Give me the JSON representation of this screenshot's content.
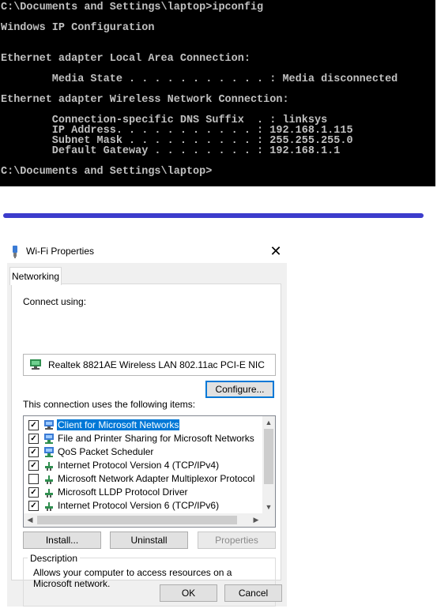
{
  "console": {
    "lines": [
      "C:\\Documents and Settings\\laptop>ipconfig",
      "Windows IP Configuration",
      "Ethernet adapter Local Area Connection:",
      "        Media State . . . . . . . . . . . : Media disconnected",
      "Ethernet adapter Wireless Network Connection:",
      "        Connection-specific DNS Suffix  . : linksys",
      "        IP Address. . . . . . . . . . . : 192.168.1.115",
      "        Subnet Mask . . . . . . . . . . : 255.255.255.0",
      "        Default Gateway . . . . . . . . : 192.168.1.1",
      "C:\\Documents and Settings\\laptop>"
    ]
  },
  "dialog": {
    "title": "Wi-Fi Properties",
    "close_glyph": "✕",
    "tab_label": "Networking",
    "connect_using_label": "Connect using:",
    "adapter_name": "Realtek 8821AE Wireless LAN 802.11ac PCI-E NIC",
    "configure_label": "Configure...",
    "items_label": "This connection uses the following items:",
    "items": [
      {
        "label": "Client for Microsoft Networks",
        "checked": true,
        "selected": true,
        "icon": "network-client-icon"
      },
      {
        "label": "File and Printer Sharing for Microsoft Networks",
        "checked": true,
        "selected": false,
        "icon": "network-service-icon"
      },
      {
        "label": "QoS Packet Scheduler",
        "checked": true,
        "selected": false,
        "icon": "network-service-icon"
      },
      {
        "label": "Internet Protocol Version 4 (TCP/IPv4)",
        "checked": true,
        "selected": false,
        "icon": "protocol-icon"
      },
      {
        "label": "Microsoft Network Adapter Multiplexor Protocol",
        "checked": false,
        "selected": false,
        "icon": "protocol-icon"
      },
      {
        "label": "Microsoft LLDP Protocol Driver",
        "checked": true,
        "selected": false,
        "icon": "protocol-icon"
      },
      {
        "label": "Internet Protocol Version 6 (TCP/IPv6)",
        "checked": true,
        "selected": false,
        "icon": "protocol-icon"
      }
    ],
    "install_label": "Install...",
    "uninstall_label": "Uninstall",
    "properties_label": "Properties",
    "description_title": "Description",
    "description_text": "Allows your computer to access resources on a Microsoft network.",
    "ok_label": "OK",
    "cancel_label": "Cancel"
  },
  "colors": {
    "console_bg": "#000000",
    "console_text": "#c0c0c0",
    "divider": "#3c3ccc",
    "selection": "#0078d7"
  }
}
